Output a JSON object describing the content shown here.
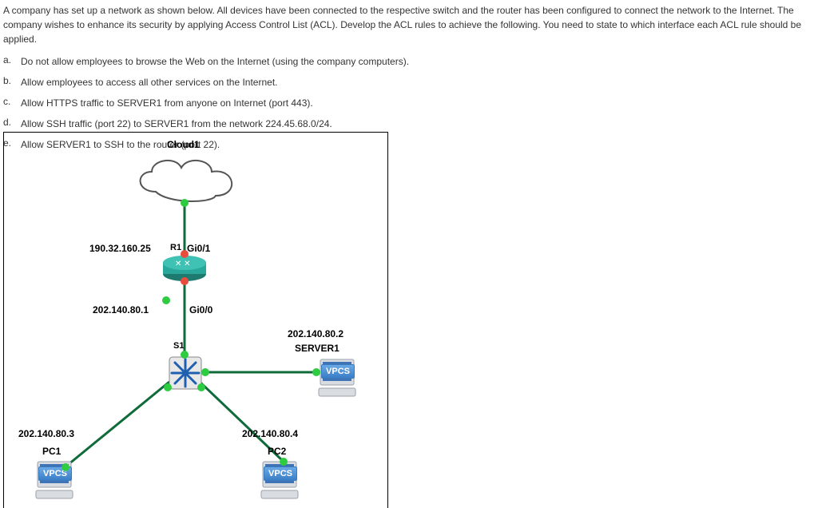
{
  "intro": "A company has set up a network as shown below. All devices have been connected to the respective switch and the router has been configured to connect the network to the Internet. The company wishes to enhance its security by applying Access Control List (ACL). Develop the ACL rules to achieve the following. You need to state to which interface each ACL rule should be applied.",
  "requirements": [
    {
      "letter": "a.",
      "text": "Do not allow employees to browse the Web on the Internet (using the company computers)."
    },
    {
      "letter": "b.",
      "text": "Allow employees to access all other services on the Internet."
    },
    {
      "letter": "c.",
      "text": "Allow HTTPS traffic to SERVER1 from anyone on Internet (port 443)."
    },
    {
      "letter": "d.",
      "text": "Allow SSH traffic (port 22) to SERVER1 from the network 224.45.68.0/24."
    },
    {
      "letter": "e.",
      "text": "Allow SERVER1 to SSH to the router (port 22)."
    }
  ],
  "diagram": {
    "cloud_label": "Cloud1",
    "router_label": "R1",
    "router_wan_ip": "190.32.160.25",
    "router_wan_if": "Gi0/1",
    "router_lan_ip": "202.140.80.1",
    "router_lan_if": "Gi0/0",
    "switch_label": "S1",
    "server": {
      "name": "SERVER1",
      "ip": "202.140.80.2",
      "badge": "VPCS"
    },
    "pc1": {
      "name": "PC1",
      "ip": "202.140.80.3",
      "badge": "VPCS"
    },
    "pc2": {
      "name": "PC2",
      "ip": "202.140.80.4",
      "badge": "VPCS"
    }
  }
}
